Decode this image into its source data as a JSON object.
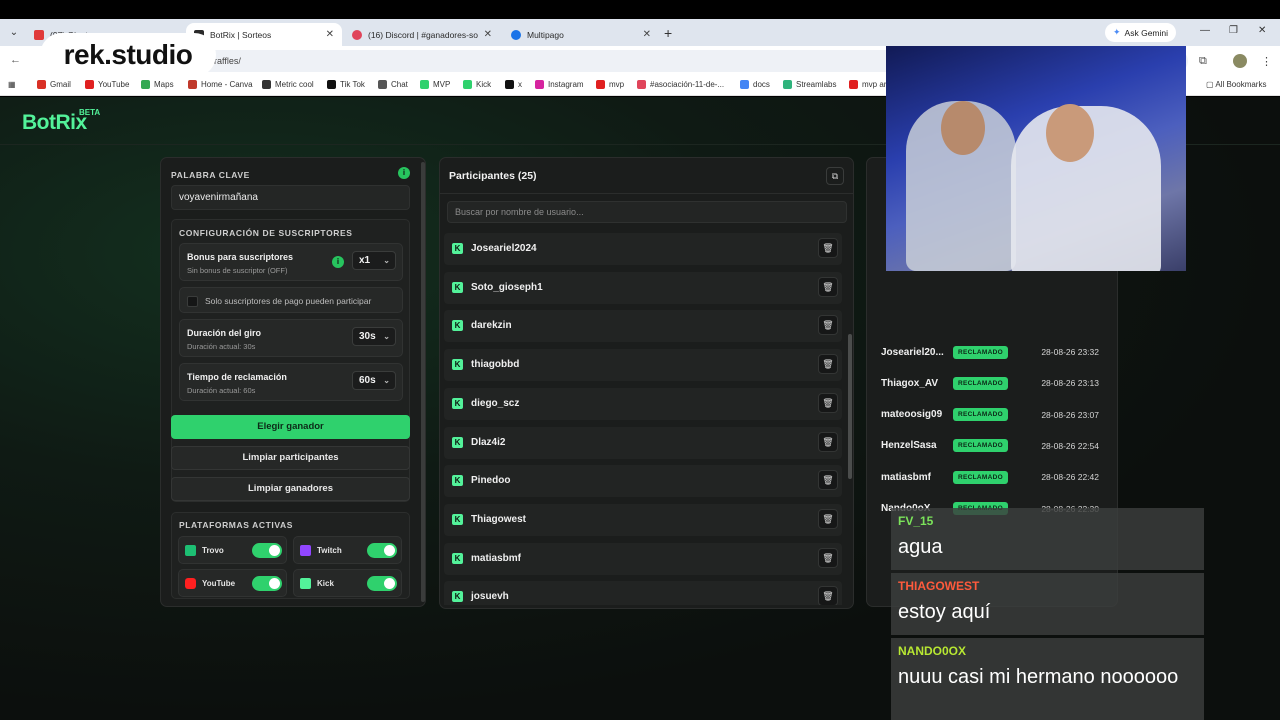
{
  "browser": {
    "tabs": [
      {
        "title": "(97) Ginatr...",
        "fav": "#e03a3a",
        "active": false
      },
      {
        "title": "BotRix | Sorteos",
        "fav": "#2a2a2a",
        "active": true
      },
      {
        "title": "(16) Discord | #ganadores-sorte...",
        "fav": "#e0445a",
        "active": false
      },
      {
        "title": "Multipago",
        "fav": "#1a73e8",
        "active": false
      }
    ],
    "ask_gemini": "Ask Gemini",
    "url_suffix": "raffles/",
    "bookmarks": [
      {
        "label": "Gmail",
        "color": "#d93025"
      },
      {
        "label": "YouTube",
        "color": "#e02020"
      },
      {
        "label": "Maps",
        "color": "#34a853"
      },
      {
        "label": "Home - Canva",
        "color": "#c0392b"
      },
      {
        "label": "Metric cool",
        "color": "#333333"
      },
      {
        "label": "Tik Tok",
        "color": "#111111"
      },
      {
        "label": "Chat",
        "color": "#555555"
      },
      {
        "label": "MVP",
        "color": "#2fd16d"
      },
      {
        "label": "Kick",
        "color": "#2fd16d"
      },
      {
        "label": "x",
        "color": "#111111"
      },
      {
        "label": "Instagram",
        "color": "#d6249f"
      },
      {
        "label": "mvp",
        "color": "#e02020"
      },
      {
        "label": "#asociación-11-de-...",
        "color": "#e0445a"
      },
      {
        "label": "docs",
        "color": "#4285f4"
      },
      {
        "label": "Streamlabs",
        "color": "#2fb37c"
      },
      {
        "label": "mvp ar",
        "color": "#e02020"
      }
    ],
    "all_bookmarks": "All Bookmarks"
  },
  "watermark": {
    "text": "rek.studio"
  },
  "app": {
    "logo": "BotRix",
    "logo_badge": "BETA",
    "left": {
      "keyword_title": "PALABRA CLAVE",
      "keyword_value": "voyavenirmañana",
      "subs_title": "CONFIGURACIÓN DE SUSCRIPTORES",
      "bonus_label": "Bonus para suscriptores",
      "bonus_sub": "Sin bonus de suscriptor (OFF)",
      "bonus_value": "x1",
      "paid_only_label": "Solo suscriptores de pago pueden participar",
      "spin_label": "Duración del giro",
      "spin_sub": "Duración actual: 30s",
      "spin_value": "30s",
      "claim_label": "Tiempo de reclamación",
      "claim_sub": "Duración actual: 60s",
      "claim_value": "60s",
      "pick_winner": "Elegir ganador",
      "clear_participants": "Limpiar participantes",
      "clear_winners": "Limpiar ganadores",
      "platforms_title": "PLATAFORMAS ACTIVAS",
      "platforms": [
        {
          "name": "Trovo",
          "color": "#1dbf73",
          "enabled": true
        },
        {
          "name": "Twitch",
          "color": "#9146ff",
          "enabled": true
        },
        {
          "name": "YouTube",
          "color": "#ff2020",
          "enabled": true
        },
        {
          "name": "Kick",
          "color": "#53f29a",
          "enabled": true
        }
      ]
    },
    "participants": {
      "title": "Participantes (25)",
      "search_placeholder": "Buscar por nombre de usuario...",
      "items": [
        "Joseariel2024",
        "Soto_gioseph1",
        "darekzin",
        "thiagobbd",
        "diego_scz",
        "Dlaz4i2",
        "Pinedoo",
        "Thiagowest",
        "matiasbmf",
        "josuevh"
      ]
    },
    "winners": [
      {
        "name": "Joseariel20...",
        "status": "RECLAMADO",
        "date": "28-08-26 23:32"
      },
      {
        "name": "Thiagox_AV",
        "status": "RECLAMADO",
        "date": "28-08-26 23:13"
      },
      {
        "name": "mateoosig09",
        "status": "RECLAMADO",
        "date": "28-08-26 23:07"
      },
      {
        "name": "HenzelSasa",
        "status": "RECLAMADO",
        "date": "28-08-26 22:54"
      },
      {
        "name": "matiasbmf",
        "status": "RECLAMADO",
        "date": "28-08-26 22:42"
      },
      {
        "name": "Nando0oX",
        "status": "RECLAMADO",
        "date": "28-08-26 22:30"
      }
    ]
  },
  "chat": [
    {
      "user": "FV_15",
      "color": "#7be35a",
      "message": "agua"
    },
    {
      "user": "THIAGOWEST",
      "color": "#ff5a3c",
      "message": "estoy aquí"
    },
    {
      "user": "NANDO0OX",
      "color": "#b8e832",
      "message": "nuuu casi mi hermano noooooo"
    }
  ]
}
